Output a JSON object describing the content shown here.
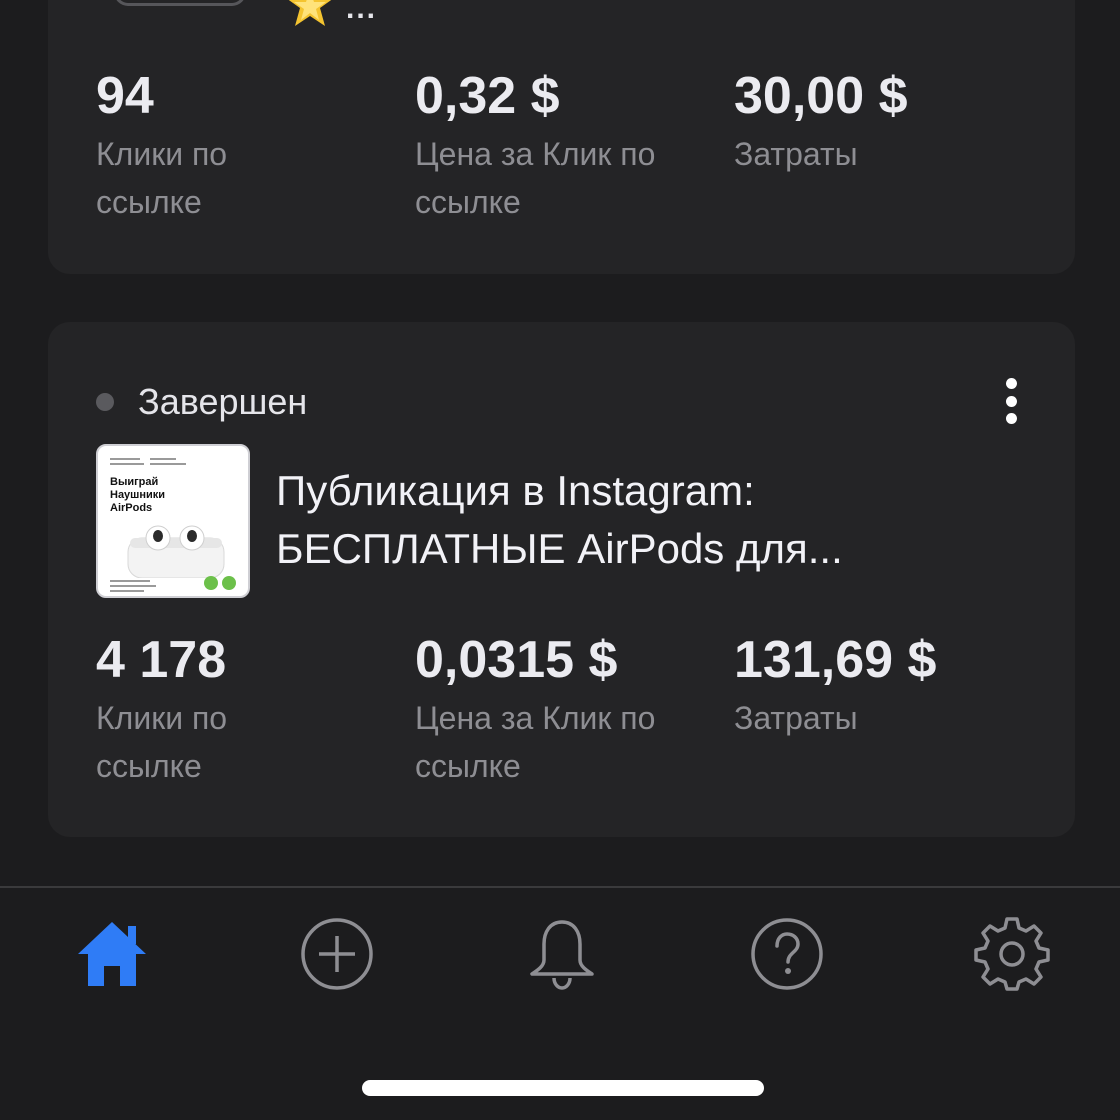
{
  "top_card": {
    "metrics": [
      {
        "value": "94",
        "label": "Клики по ссылке"
      },
      {
        "value": "0,32 $",
        "label": "Цена за Клик по ссылке"
      },
      {
        "value": "30,00 $",
        "label": "Затраты"
      }
    ],
    "ellipsis": "..."
  },
  "main_card": {
    "status": "Завершен",
    "thumbnail": {
      "headline": "Выиграй\nНаушники\nAirPods"
    },
    "title": "Публикация в Instagram: БЕСПЛАТНЫЕ AirPods для...",
    "metrics": [
      {
        "value": "4 178",
        "label": "Клики по ссылке"
      },
      {
        "value": "0,0315 $",
        "label": "Цена за Клик по ссылке"
      },
      {
        "value": "131,69 $",
        "label": "Затраты"
      }
    ]
  },
  "tabbar": {
    "tabs": [
      {
        "name": "home",
        "icon": "home-icon",
        "active": true
      },
      {
        "name": "create",
        "icon": "plus-circle-icon",
        "active": false
      },
      {
        "name": "notifications",
        "icon": "bell-icon",
        "active": false
      },
      {
        "name": "help",
        "icon": "question-circle-icon",
        "active": false
      },
      {
        "name": "settings",
        "icon": "gear-icon",
        "active": false
      }
    ]
  },
  "colors": {
    "background": "#1c1c1e",
    "card": "#242426",
    "accent": "#2f7cf6",
    "label": "#8e8e93"
  }
}
